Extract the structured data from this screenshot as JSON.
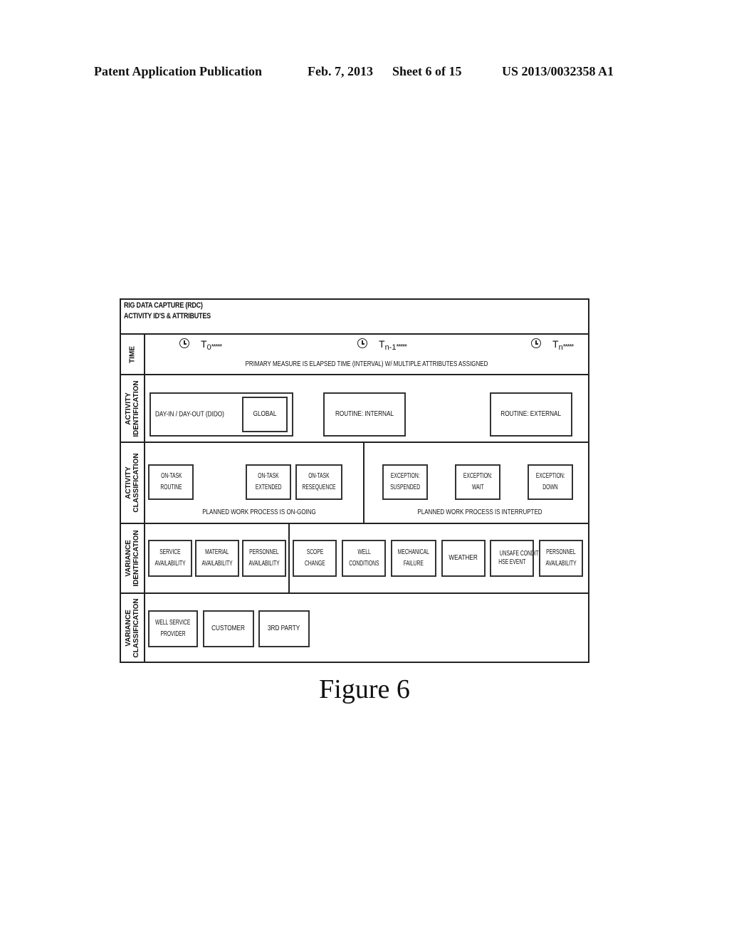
{
  "header": {
    "title": "Patent Application Publication",
    "date": "Feb. 7, 2013",
    "sheet": "Sheet 6 of 15",
    "number": "US 2013/0032358 A1"
  },
  "diagram": {
    "title_line1": "RIG DATA CAPTURE (RDC)",
    "title_line2": "ACTIVITY ID'S & ATTRIBUTES",
    "time": {
      "label": "TIME",
      "markers": [
        {
          "icon": "clock-icon",
          "base": "T",
          "sub": "0",
          "suffix": "*****"
        },
        {
          "icon": "clock-icon",
          "base": "T",
          "sub": "n-1",
          "suffix": "*****"
        },
        {
          "icon": "clock-icon",
          "base": "T",
          "sub": "n",
          "suffix": "*****"
        }
      ],
      "caption": "PRIMARY MEASURE IS ELAPSED TIME (INTERVAL) W/ MULTIPLE ATTRIBUTES ASSIGNED"
    },
    "activity_identification": {
      "label_line1": "ACTIVITY",
      "label_line2": "IDENTIFICATION",
      "dido_label": "DAY-IN / DAY-OUT (DIDO)",
      "global_label": "GLOBAL",
      "routine_internal": "ROUTINE: INTERNAL",
      "routine_external": "ROUTINE: EXTERNAL"
    },
    "activity_classification": {
      "label_line1": "ACTIVITY",
      "label_line2": "CLASSIFICATION",
      "ongoing": {
        "items": [
          {
            "line1": "ON-TASK",
            "line2": "ROUTINE"
          },
          {
            "line1": "ON-TASK",
            "line2": "EXTENDED"
          },
          {
            "line1": "ON-TASK",
            "line2": "RESEQUENCE"
          }
        ],
        "caption": "PLANNED WORK PROCESS IS ON-GOING"
      },
      "interrupted": {
        "items": [
          {
            "line1": "EXCEPTION:",
            "line2": "SUSPENDED"
          },
          {
            "line1": "EXCEPTION:",
            "line2": "WAIT"
          },
          {
            "line1": "EXCEPTION:",
            "line2": "DOWN"
          }
        ],
        "caption": "PLANNED WORK PROCESS IS INTERRUPTED"
      }
    },
    "variance_identification": {
      "label_line1": "VARIANCE",
      "label_line2": "IDENTIFICATION",
      "left_items": [
        {
          "line1": "SERVICE",
          "line2": "AVAILABILITY"
        },
        {
          "line1": "MATERIAL",
          "line2": "AVAILABILITY"
        },
        {
          "line1": "PERSONNEL",
          "line2": "AVAILABILITY"
        }
      ],
      "right_items": [
        {
          "line1": "SCOPE",
          "line2": "CHANGE"
        },
        {
          "line1": "WELL",
          "line2": "CONDITIONS"
        },
        {
          "line1": "MECHANICAL",
          "line2": "FAILURE"
        },
        {
          "line1": "WEATHER",
          "line2": ""
        },
        {
          "line1": "UNSAFE CONDITION",
          "line2": "HSE EVENT"
        },
        {
          "line1": "PERSONNEL",
          "line2": "AVAILABILITY"
        }
      ]
    },
    "variance_classification": {
      "label_line1": "VARIANCE",
      "label_line2": "CLASSIFICATION",
      "items": [
        {
          "line1": "WELL SERVICE",
          "line2": "PROVIDER"
        },
        {
          "line1": "CUSTOMER",
          "line2": ""
        },
        {
          "line1": "3RD PARTY",
          "line2": ""
        }
      ]
    }
  },
  "figure_caption": "Figure 6"
}
